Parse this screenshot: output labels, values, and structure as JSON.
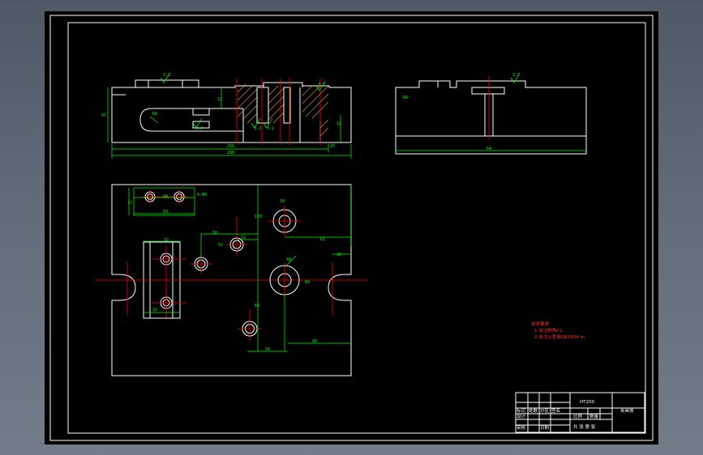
{
  "drawing": {
    "colors": {
      "background": "#000000",
      "outline": "#ffffff",
      "dimension": "#00ff00",
      "centerline": "#ff0000",
      "section_hatch": "#e8a23a"
    },
    "dims": {
      "front": {
        "overall_length": "288",
        "inner_length": "250",
        "right_offset": "25",
        "height": "47",
        "h_right": "12",
        "h_right2": "12",
        "slot_depth": "12",
        "label_r": "R8",
        "r1": "R25",
        "r2": "R12"
      },
      "side": {
        "length": "64",
        "h_small": "R8"
      },
      "plan": {
        "a1": "17",
        "a2": "80",
        "a3": "10",
        "a4": "120",
        "a5": "120",
        "a6": "80",
        "a7": "50",
        "a8": "52",
        "a9": "4-M8",
        "a10": "20",
        "b1": "30",
        "b2": "62",
        "b3": "80",
        "b4": "12",
        "b5": "80",
        "b6": "50",
        "b7": "50",
        "b8": "32",
        "b9": "32",
        "b10": "10",
        "b11": "40",
        "b12": "60",
        "b13": "50",
        "b14": "90",
        "b15": "2"
      },
      "roughness": {
        "r1": "3.2",
        "r2": "3.2",
        "r3": "3.2",
        "r4": "3.2",
        "r5": "3.2",
        "r6": "3.2",
        "r7": "3.2",
        "r8": "3.2"
      }
    },
    "notes": {
      "title": "技术要求",
      "line1": "1.未注倒角C1",
      "line2": "2.未注公差按GB1804-m"
    },
    "title_block": {
      "material": "HT200",
      "name": "夹具体",
      "scale": "比例",
      "qty": "数量",
      "sheet": "共 张 第 张",
      "designer": "设计",
      "checker": "审核",
      "date": "日期",
      "c1": "标记",
      "c2": "处数",
      "c3": "分区",
      "c4": "更改文件号",
      "c5": "签名",
      "c6": "年月日"
    }
  }
}
